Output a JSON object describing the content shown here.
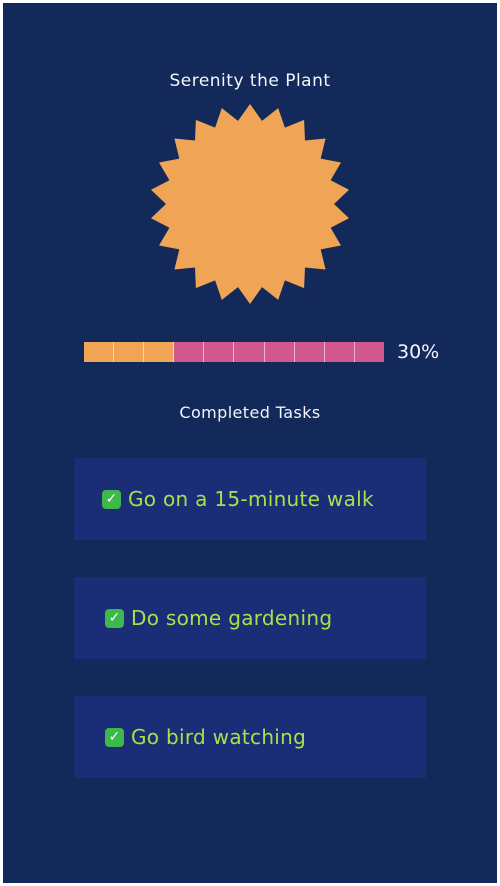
{
  "plant": {
    "name": "Serenity the Plant",
    "color": "#f0a455",
    "shape": "starburst"
  },
  "progress": {
    "fraction": 0.3,
    "label": "30%",
    "segments": 10,
    "done_color": "#f0a455",
    "todo_color": "#d3578f"
  },
  "tasks": {
    "heading": "Completed Tasks",
    "check_icon": "checkbox-checked-icon",
    "check_color": "#3db84a",
    "text_color": "#a9e04a",
    "items": [
      {
        "label": "Go on a 15-minute walk"
      },
      {
        "label": "Do some gardening"
      },
      {
        "label": "Go bird watching"
      }
    ]
  }
}
